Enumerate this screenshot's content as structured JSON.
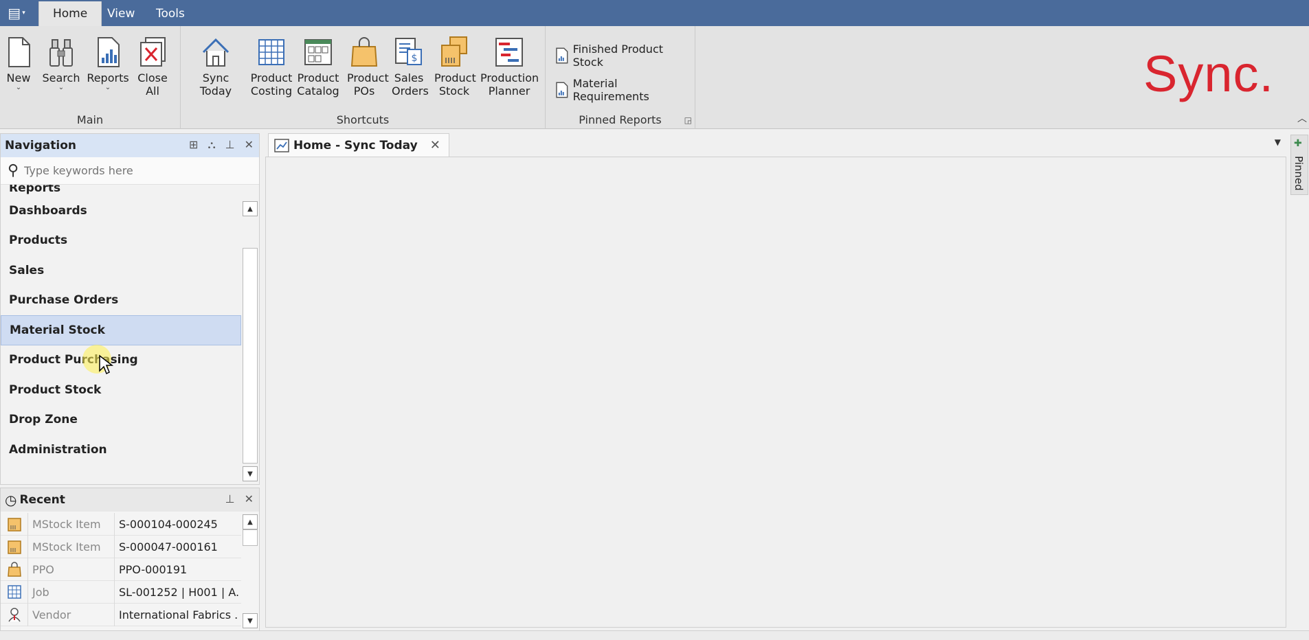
{
  "ribbon_tabs": [
    {
      "label": "Home",
      "active": true
    },
    {
      "label": "View",
      "active": false
    },
    {
      "label": "Tools",
      "active": false
    }
  ],
  "groups": {
    "main": {
      "label": "Main",
      "buttons": [
        {
          "label": "New",
          "icon": "new-document-icon"
        },
        {
          "label": "Search",
          "icon": "binoculars-icon"
        },
        {
          "label": "Reports",
          "icon": "report-icon"
        },
        {
          "label": "Close All",
          "icon": "close-all-icon"
        }
      ]
    },
    "shortcuts": {
      "label": "Shortcuts",
      "buttons": [
        {
          "label": "Sync Today",
          "icon": "home-icon"
        },
        {
          "label": "Product Costing",
          "icon": "spreadsheet-icon"
        },
        {
          "label": "Product Catalog",
          "icon": "catalog-icon"
        },
        {
          "label": "Product POs",
          "icon": "shopping-bag-icon"
        },
        {
          "label": "Sales Orders",
          "icon": "sales-order-icon"
        },
        {
          "label": "Product Stock",
          "icon": "box-icon"
        },
        {
          "label": "Production Planner",
          "icon": "gantt-icon"
        }
      ]
    },
    "pinned_reports": {
      "label": "Pinned Reports",
      "items": [
        "Finished Product Stock",
        "Material Requirements"
      ]
    }
  },
  "brand": "Sync.",
  "colors": {
    "title_bar": "#4a6b9b",
    "brand_red": "#d9252f",
    "nav_header": "#d8e4f5",
    "selected": "#cfdcf2"
  },
  "navigation": {
    "title": "Navigation",
    "search_placeholder": "Type keywords here",
    "items": [
      "Reports",
      "Dashboards",
      "Products",
      "Sales",
      "Purchase Orders",
      "Material Stock",
      "Product Purchasing",
      "Product Stock",
      "Drop Zone",
      "Administration"
    ],
    "selected": "Material Stock"
  },
  "recent": {
    "title": "Recent",
    "rows": [
      {
        "type": "MStock Item",
        "value": "S-000104-000245",
        "icon": "stock-box-icon"
      },
      {
        "type": "MStock Item",
        "value": "S-000047-000161",
        "icon": "stock-box-icon"
      },
      {
        "type": "PPO",
        "value": "PPO-000191",
        "icon": "shopping-bag-icon"
      },
      {
        "type": "Job",
        "value": "SL-001252 | H001 | A...",
        "icon": "grid-icon"
      },
      {
        "type": "Vendor",
        "value": "International Fabrics ...",
        "icon": "person-icon"
      }
    ]
  },
  "document": {
    "tab_title": "Home - Sync Today"
  },
  "side_panel": {
    "label": "Pinned"
  }
}
